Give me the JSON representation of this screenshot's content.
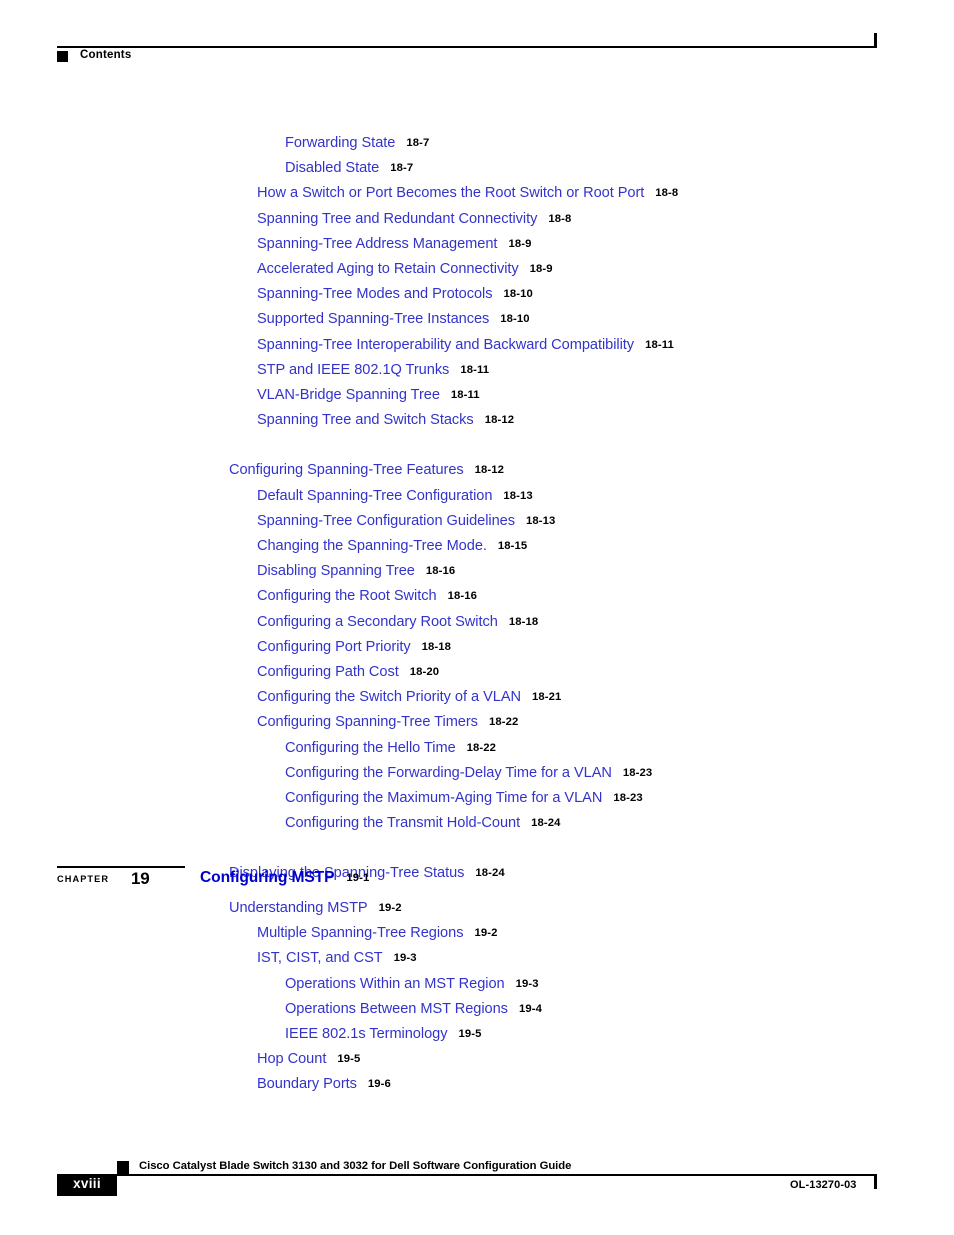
{
  "header": {
    "label": "Contents",
    "square_icon": "black-square-bullet-icon"
  },
  "toc": {
    "entries": [
      {
        "level": 3,
        "title": "Forwarding State",
        "page": "18-7"
      },
      {
        "level": 3,
        "title": "Disabled State",
        "page": "18-7"
      },
      {
        "level": 2,
        "title": "How a Switch or Port Becomes the Root Switch or Root Port",
        "page": "18-8"
      },
      {
        "level": 2,
        "title": "Spanning Tree and Redundant Connectivity",
        "page": "18-8"
      },
      {
        "level": 2,
        "title": "Spanning-Tree Address Management",
        "page": "18-9"
      },
      {
        "level": 2,
        "title": "Accelerated Aging to Retain Connectivity",
        "page": "18-9"
      },
      {
        "level": 2,
        "title": "Spanning-Tree Modes and Protocols",
        "page": "18-10"
      },
      {
        "level": 2,
        "title": "Supported Spanning-Tree Instances",
        "page": "18-10"
      },
      {
        "level": 2,
        "title": "Spanning-Tree Interoperability and Backward Compatibility",
        "page": "18-11"
      },
      {
        "level": 2,
        "title": "STP and IEEE 802.1Q Trunks",
        "page": "18-11"
      },
      {
        "level": 2,
        "title": "VLAN-Bridge Spanning Tree",
        "page": "18-11"
      },
      {
        "level": 2,
        "title": "Spanning Tree and Switch Stacks",
        "page": "18-12"
      },
      {
        "level": 0,
        "title": "",
        "page": ""
      },
      {
        "level": 1,
        "title": "Configuring Spanning-Tree Features",
        "page": "18-12"
      },
      {
        "level": 2,
        "title": "Default Spanning-Tree Configuration",
        "page": "18-13"
      },
      {
        "level": 2,
        "title": "Spanning-Tree Configuration Guidelines",
        "page": "18-13"
      },
      {
        "level": 2,
        "title": "Changing the Spanning-Tree Mode.",
        "page": "18-15"
      },
      {
        "level": 2,
        "title": "Disabling Spanning Tree",
        "page": "18-16"
      },
      {
        "level": 2,
        "title": "Configuring the Root Switch",
        "page": "18-16"
      },
      {
        "level": 2,
        "title": "Configuring a Secondary Root Switch",
        "page": "18-18"
      },
      {
        "level": 2,
        "title": "Configuring Port Priority",
        "page": "18-18"
      },
      {
        "level": 2,
        "title": "Configuring Path Cost",
        "page": "18-20"
      },
      {
        "level": 2,
        "title": "Configuring the Switch Priority of a VLAN",
        "page": "18-21"
      },
      {
        "level": 2,
        "title": "Configuring Spanning-Tree Timers",
        "page": "18-22"
      },
      {
        "level": 3,
        "title": "Configuring the Hello Time",
        "page": "18-22"
      },
      {
        "level": 3,
        "title": "Configuring the Forwarding-Delay Time for a VLAN",
        "page": "18-23"
      },
      {
        "level": 3,
        "title": "Configuring the Maximum-Aging Time for a VLAN",
        "page": "18-23"
      },
      {
        "level": 3,
        "title": "Configuring the Transmit Hold-Count",
        "page": "18-24"
      },
      {
        "level": 0,
        "title": "",
        "page": ""
      },
      {
        "level": 1,
        "title": "Displaying the Spanning-Tree Status",
        "page": "18-24"
      }
    ]
  },
  "chapter": {
    "word": "CHAPTER",
    "number": "19",
    "title": "Configuring MSTP",
    "page": "19-1"
  },
  "chapter_toc": {
    "entries": [
      {
        "level": 1,
        "title": "Understanding MSTP",
        "page": "19-2"
      },
      {
        "level": 2,
        "title": "Multiple Spanning-Tree Regions",
        "page": "19-2"
      },
      {
        "level": 2,
        "title": "IST, CIST, and CST",
        "page": "19-3"
      },
      {
        "level": 3,
        "title": "Operations Within an MST Region",
        "page": "19-3"
      },
      {
        "level": 3,
        "title": "Operations Between MST Regions",
        "page": "19-4"
      },
      {
        "level": 3,
        "title": "IEEE 802.1s Terminology",
        "page": "19-5"
      },
      {
        "level": 2,
        "title": "Hop Count",
        "page": "19-5"
      },
      {
        "level": 2,
        "title": "Boundary Ports",
        "page": "19-6"
      }
    ]
  },
  "footer": {
    "page_number": "xviii",
    "document_title": "Cisco Catalyst Blade Switch 3130 and 3032 for Dell Software Configuration Guide",
    "document_id": "OL-13270-03",
    "square_icon": "black-square-marker-icon"
  },
  "colors": {
    "link_blue": "#3333cc",
    "chapter_blue": "#0000cc",
    "text_black": "#000000",
    "page_background": "#ffffff"
  }
}
